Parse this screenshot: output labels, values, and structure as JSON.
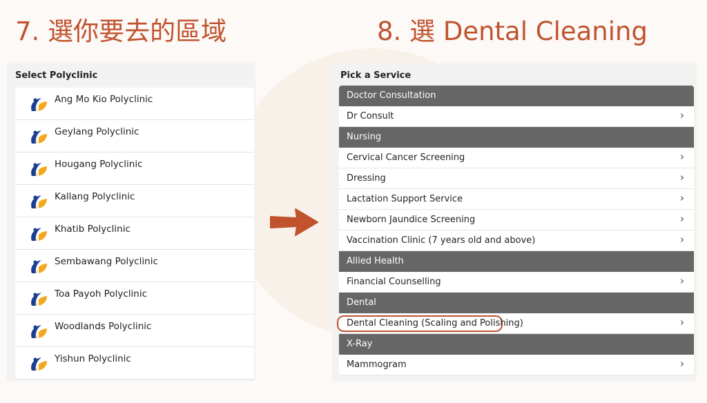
{
  "titles": {
    "left": "7. 選你要去的區域",
    "right": "8. 選 Dental Cleaning"
  },
  "left_panel": {
    "header": "Select Polyclinic",
    "items": [
      {
        "label": "Ang Mo Kio Polyclinic"
      },
      {
        "label": "Geylang Polyclinic"
      },
      {
        "label": "Hougang Polyclinic"
      },
      {
        "label": "Kallang Polyclinic"
      },
      {
        "label": "Khatib Polyclinic"
      },
      {
        "label": "Sembawang Polyclinic"
      },
      {
        "label": "Toa Payoh Polyclinic"
      },
      {
        "label": "Woodlands Polyclinic"
      },
      {
        "label": "Yishun Polyclinic"
      }
    ]
  },
  "right_panel": {
    "header": "Pick a Service",
    "categories": [
      {
        "name": "Doctor Consultation",
        "services": [
          "Dr Consult"
        ]
      },
      {
        "name": "Nursing",
        "services": [
          "Cervical Cancer Screening",
          "Dressing",
          "Lactation Support Service",
          "Newborn Jaundice Screening",
          "Vaccination Clinic (7 years old and above)"
        ]
      },
      {
        "name": "Allied Health",
        "services": [
          "Financial Counselling"
        ]
      },
      {
        "name": "Dental",
        "services": [
          "Dental Cleaning (Scaling and Polishing)"
        ]
      },
      {
        "name": "X-Ray",
        "services": [
          "Mammogram"
        ]
      }
    ],
    "highlighted_service": "Dental Cleaning (Scaling and Polishing)",
    "chevron": "›"
  },
  "colors": {
    "accent": "#c0532e",
    "category_bg": "#666666",
    "logo_blue": "#1b3f8f",
    "logo_orange": "#f4a81d"
  },
  "icons": {
    "polyclinic_logo": "polyclinic-logo-icon",
    "arrow": "arrow-right-icon",
    "chevron": "chevron-right-icon"
  }
}
